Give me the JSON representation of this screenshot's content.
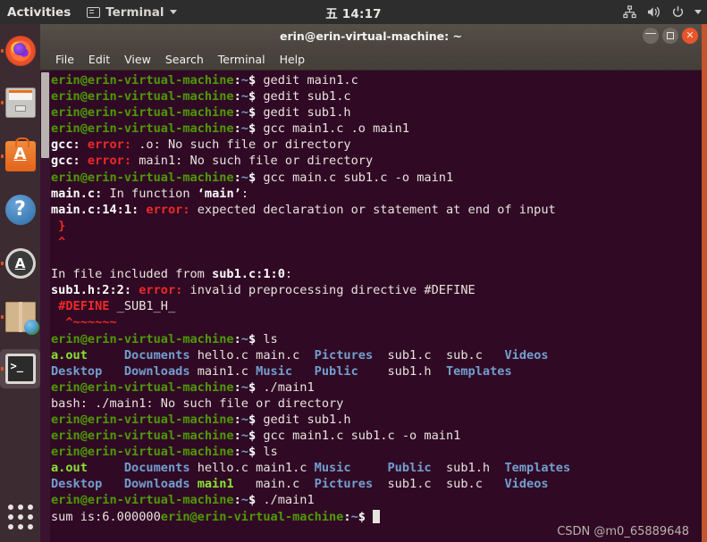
{
  "topbar": {
    "activities": "Activities",
    "app_name": "Terminal",
    "app_icon": "terminal-icon",
    "clock": "五 14:17",
    "icons": [
      "network-icon",
      "volume-icon",
      "power-icon",
      "chevron-down-icon"
    ]
  },
  "dock": {
    "items": [
      {
        "name": "firefox",
        "label": "Firefox",
        "running": true,
        "active": false
      },
      {
        "name": "files",
        "label": "Files",
        "running": true,
        "active": false
      },
      {
        "name": "ubuntu-software",
        "label": "Ubuntu Software",
        "running": true,
        "active": false
      },
      {
        "name": "help",
        "label": "Help",
        "glyph": "?",
        "running": false,
        "active": false
      },
      {
        "name": "software-updater",
        "label": "Software Updater",
        "glyph": "A",
        "running": true,
        "active": false
      },
      {
        "name": "amazon",
        "label": "Amazon",
        "running": true,
        "active": false
      },
      {
        "name": "terminal",
        "label": "Terminal",
        "running": true,
        "active": true
      }
    ],
    "show_applications": "Show Applications"
  },
  "window": {
    "title": "erin@erin-virtual-machine: ~",
    "controls": {
      "minimize": "minimize",
      "maximize": "maximize",
      "close": "close"
    },
    "menu": [
      "File",
      "Edit",
      "View",
      "Search",
      "Terminal",
      "Help"
    ]
  },
  "terminal": {
    "prompt": {
      "user_host": "erin@erin-virtual-machine",
      "colon": ":",
      "cwd": "~",
      "sigil": "$"
    },
    "colors": {
      "background": "#300a24",
      "foreground": "#e8e3df",
      "green": "#4e9a06",
      "bright_green": "#8ae234",
      "blue": "#729fcf",
      "red": "#ef2929",
      "accent": "#e95420"
    },
    "lines": [
      {
        "type": "prompt",
        "command": "gedit main1.c"
      },
      {
        "type": "prompt",
        "command": "gedit sub1.c"
      },
      {
        "type": "prompt",
        "command": "gedit sub1.h"
      },
      {
        "type": "prompt",
        "command": "gcc main1.c .o main1"
      },
      {
        "type": "gcc-error",
        "tool": "gcc:",
        "err": " error:",
        "rest": " .o: No such file or directory"
      },
      {
        "type": "gcc-error",
        "tool": "gcc:",
        "err": " error:",
        "rest": " main1: No such file or directory"
      },
      {
        "type": "prompt",
        "command": "gcc main.c sub1.c -o main1"
      },
      {
        "type": "gcc-note",
        "bold": "main.c:",
        "rest": " In function ",
        "quoted": "‘main’",
        "tail": ":"
      },
      {
        "type": "gcc-error",
        "tool": "main.c:14:1:",
        "err": " error:",
        "rest": " expected declaration or statement at end of input"
      },
      {
        "type": "code-red",
        "text": " }"
      },
      {
        "type": "code-red",
        "text": " ^"
      },
      {
        "type": "blank",
        "text": ""
      },
      {
        "type": "include-note",
        "pre": "In file included from ",
        "bold": "sub1.c:1:0",
        "tail": ":"
      },
      {
        "type": "gcc-error",
        "tool": "sub1.h:2:2:",
        "err": " error:",
        "rest": " invalid preprocessing directive #DEFINE"
      },
      {
        "type": "code-mixed",
        "red": " #DEFINE",
        "white": " _SUB1_H_"
      },
      {
        "type": "code-red",
        "text": "  ^~~~~~~"
      },
      {
        "type": "prompt",
        "command": "ls"
      },
      {
        "type": "ls",
        "row": [
          {
            "t": "a.out",
            "c": "exe"
          },
          {
            "t": "Documents",
            "c": "dir"
          },
          {
            "t": "hello.c",
            "c": "file"
          },
          {
            "t": "main.c",
            "c": "file"
          },
          {
            "t": "Pictures",
            "c": "dir"
          },
          {
            "t": "sub1.c",
            "c": "file"
          },
          {
            "t": "sub.c",
            "c": "file"
          },
          {
            "t": "Videos",
            "c": "dir"
          }
        ]
      },
      {
        "type": "ls",
        "row": [
          {
            "t": "Desktop",
            "c": "dir"
          },
          {
            "t": "Downloads",
            "c": "dir"
          },
          {
            "t": "main1.c",
            "c": "file"
          },
          {
            "t": "Music",
            "c": "dir"
          },
          {
            "t": "Public",
            "c": "dir"
          },
          {
            "t": "sub1.h",
            "c": "file"
          },
          {
            "t": "Templates",
            "c": "dir"
          }
        ]
      },
      {
        "type": "prompt",
        "command": "./main1"
      },
      {
        "type": "plain",
        "text": "bash: ./main1: No such file or directory"
      },
      {
        "type": "prompt",
        "command": "gedit sub1.h"
      },
      {
        "type": "prompt",
        "command": "gcc main1.c sub1.c -o main1"
      },
      {
        "type": "prompt",
        "command": "ls"
      },
      {
        "type": "ls2",
        "row": [
          {
            "t": "a.out",
            "c": "exe"
          },
          {
            "t": "Documents",
            "c": "dir"
          },
          {
            "t": "hello.c",
            "c": "file"
          },
          {
            "t": "main1.c",
            "c": "file"
          },
          {
            "t": "Music",
            "c": "dir"
          },
          {
            "t": "Public",
            "c": "dir"
          },
          {
            "t": "sub1.h",
            "c": "file"
          },
          {
            "t": "Templates",
            "c": "dir"
          }
        ]
      },
      {
        "type": "ls2",
        "row": [
          {
            "t": "Desktop",
            "c": "dir"
          },
          {
            "t": "Downloads",
            "c": "dir"
          },
          {
            "t": "main1",
            "c": "exe"
          },
          {
            "t": "main.c",
            "c": "file"
          },
          {
            "t": "Pictures",
            "c": "dir"
          },
          {
            "t": "sub1.c",
            "c": "file"
          },
          {
            "t": "sub.c",
            "c": "file"
          },
          {
            "t": "Videos",
            "c": "dir"
          }
        ]
      },
      {
        "type": "prompt",
        "command": "./main1"
      },
      {
        "type": "output-then-prompt",
        "output": "sum is:6.000000",
        "cursor": true
      }
    ]
  },
  "watermark": "CSDN @m0_65889648"
}
